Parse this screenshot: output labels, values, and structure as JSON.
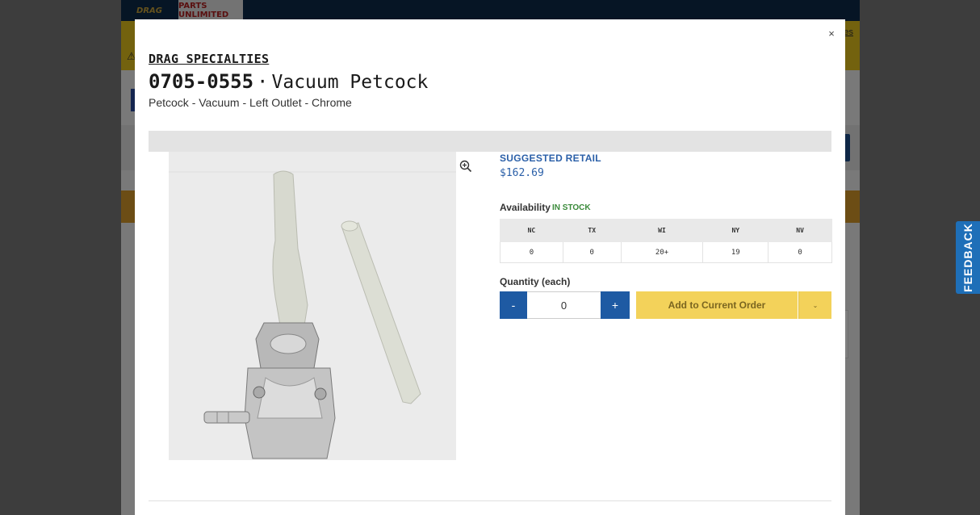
{
  "background": {
    "tabs": {
      "drag": "DRAG",
      "parts_unlimited": "PARTS UNLIMITED"
    },
    "top_link": "es"
  },
  "feedback": {
    "label": "FEEDBACK"
  },
  "modal": {
    "close_label": "×",
    "brand": "DRAG SPECIALTIES",
    "part_number": "0705-0555",
    "separator": "·",
    "product_name": "Vacuum Petcock",
    "description": "Petcock - Vacuum - Left Outlet - Chrome",
    "price": {
      "label": "SUGGESTED RETAIL",
      "value": "$162.69"
    },
    "availability": {
      "label": "Availability",
      "status": "IN STOCK"
    },
    "warehouses": {
      "headers": [
        "NC",
        "TX",
        "WI",
        "NY",
        "NV"
      ],
      "values": [
        "0",
        "0",
        "20+",
        "19",
        "0"
      ]
    },
    "quantity": {
      "label": "Quantity (each)",
      "minus": "-",
      "plus": "+",
      "value": "0"
    },
    "add_button": "Add to Current Order",
    "dropdown_icon": "chevron-down-icon",
    "zoom_icon": "zoom-in-icon"
  },
  "colors": {
    "accent": "#1e5aa3",
    "add_button": "#f3d25a",
    "in_stock": "#3a8a3a",
    "price": "#2a5fa8"
  }
}
